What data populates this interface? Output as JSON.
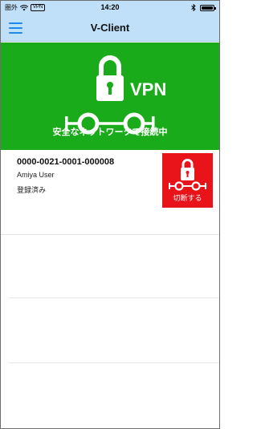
{
  "status_bar": {
    "carrier": "圏外",
    "vpn_badge": "VPN",
    "time": "14:20",
    "wifi_icon": "wifi-icon",
    "bluetooth_icon": "bluetooth-icon",
    "battery_level": 1.0
  },
  "nav": {
    "title": "V-Client",
    "menu_icon": "hamburger-menu-icon",
    "accent_color": "#1e88e5"
  },
  "banner": {
    "vpn_label": "VPN",
    "status_text": "安全なネットワークで接続中",
    "background_color": "#1aab1a",
    "icons": [
      "lock-icon",
      "network-connection-icon"
    ]
  },
  "connection": {
    "id": "0000-0021-0001-000008",
    "user": "Amiya User",
    "status": "登録済み",
    "disconnect_label": "切断する",
    "disconnect_color": "#e8141a"
  }
}
